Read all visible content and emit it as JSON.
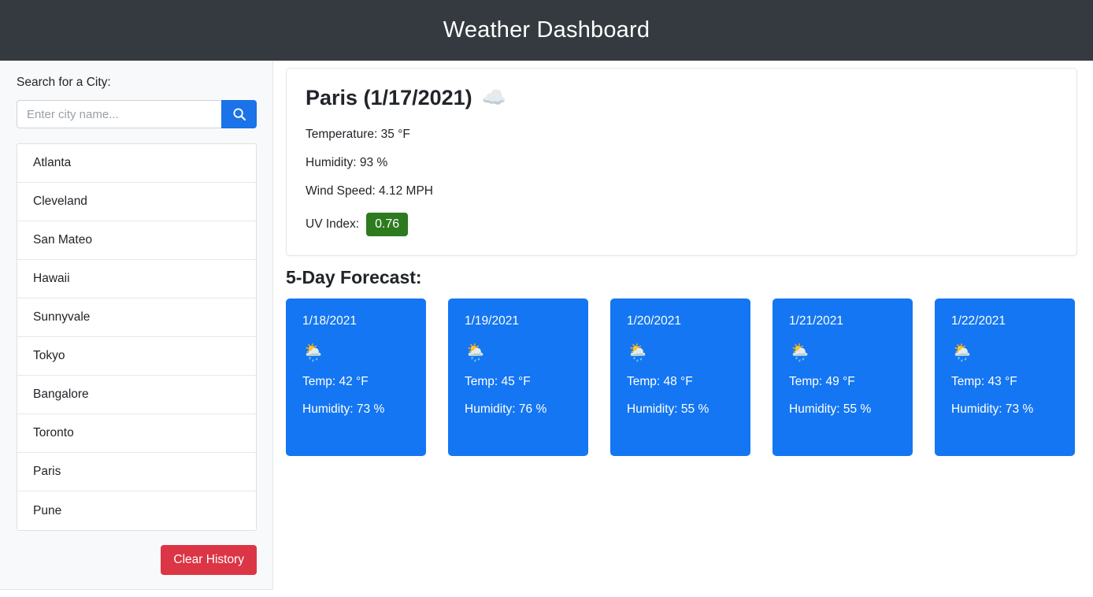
{
  "header": {
    "title": "Weather Dashboard"
  },
  "sidebar": {
    "search_label": "Search for a City:",
    "search_placeholder": "Enter city name...",
    "search_value": "",
    "search_icon": "search-icon",
    "clear_label": "Clear History",
    "cities": [
      "Atlanta",
      "Cleveland",
      "San Mateo",
      "Hawaii",
      "Sunnyvale",
      "Tokyo",
      "Bangalore",
      "Toronto",
      "Paris",
      "Pune"
    ]
  },
  "current": {
    "title": "Paris (1/17/2021)",
    "icon": "☁️",
    "icon_name": "cloud-icon",
    "temperature": "Temperature: 35 °F",
    "humidity": "Humidity: 93 %",
    "wind": "Wind Speed: 4.12 MPH",
    "uv_label": "UV Index:",
    "uv_value": "0.76",
    "uv_color": "#2d7a1f"
  },
  "forecast": {
    "heading": "5-Day Forecast:",
    "days": [
      {
        "date": "1/18/2021",
        "icon": "🌦️",
        "icon_name": "sun-behind-rain-cloud-icon",
        "temp": "Temp: 42 °F",
        "humidity": "Humidity: 73 %"
      },
      {
        "date": "1/19/2021",
        "icon": "🌦️",
        "icon_name": "sun-behind-rain-cloud-icon",
        "temp": "Temp: 45 °F",
        "humidity": "Humidity: 76 %"
      },
      {
        "date": "1/20/2021",
        "icon": "🌦️",
        "icon_name": "sun-behind-rain-cloud-icon",
        "temp": "Temp: 48 °F",
        "humidity": "Humidity: 55 %"
      },
      {
        "date": "1/21/2021",
        "icon": "🌦️",
        "icon_name": "sun-behind-rain-cloud-icon",
        "temp": "Temp: 49 °F",
        "humidity": "Humidity: 55 %"
      },
      {
        "date": "1/22/2021",
        "icon": "🌦️",
        "icon_name": "sun-behind-rain-cloud-icon",
        "temp": "Temp: 43 °F",
        "humidity": "Humidity: 73 %"
      }
    ]
  },
  "colors": {
    "header_bg": "#343a40",
    "accent_blue": "#1a73e8",
    "card_blue": "#1476f2",
    "danger_red": "#dc3545",
    "sidebar_bg": "#f8f9fa"
  }
}
